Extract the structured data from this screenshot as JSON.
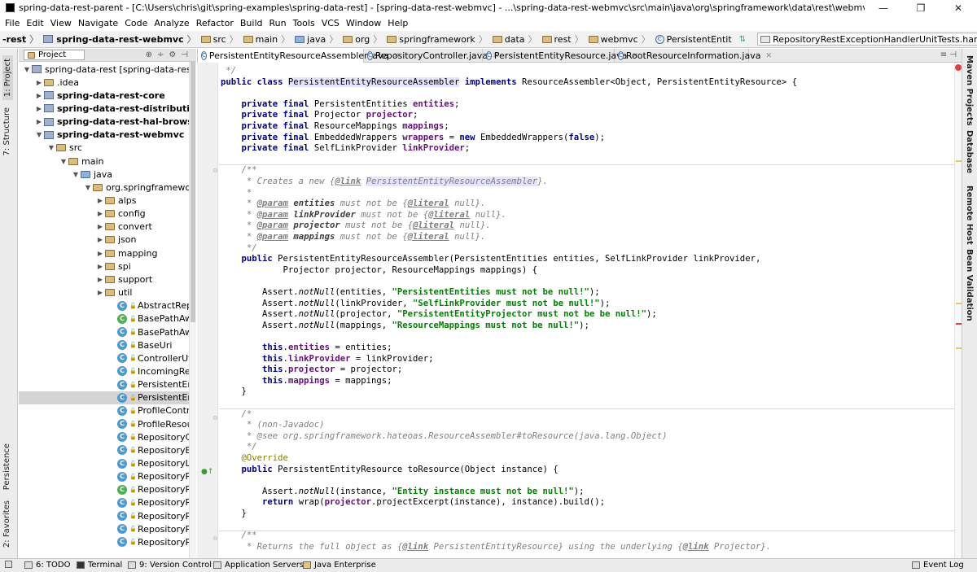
{
  "window": {
    "title": "spring-data-rest-parent - [C:\\Users\\chris\\git\\spring-examples\\spring-data-rest] - [spring-data-rest-webmvc] - ...\\spring-data-rest-webmvc\\src\\main\\java\\org\\springframework\\data\\rest\\webmvc\\PersistentEntityResourceAssembler.java - IntelliJ ID...",
    "controls": [
      "—",
      "❐",
      "✕"
    ]
  },
  "menu": [
    "File",
    "Edit",
    "View",
    "Navigate",
    "Code",
    "Analyze",
    "Refactor",
    "Build",
    "Run",
    "Tools",
    "VCS",
    "Window",
    "Help"
  ],
  "breadcrumbs": [
    "-rest",
    "spring-data-rest-webmvc",
    "src",
    "main",
    "java",
    "org",
    "springframework",
    "data",
    "rest",
    "webmvc",
    "PersistentEntit"
  ],
  "run_config": "RepositoryRestExceptionHandlerUnitTests.handlesConflictCorrectly",
  "left_tools": [
    "1: Project",
    "7: Structure",
    "Persistence",
    "2: Favorites"
  ],
  "right_tools": [
    "Maven Projects",
    "Database",
    "Remote Host",
    "Bean Validation"
  ],
  "project_panel": {
    "view": "Project",
    "tree": [
      {
        "label": "spring-data-rest [spring-data-rest-pare",
        "icon": "module",
        "level": 0,
        "arrow": "down",
        "bold": false
      },
      {
        "label": ".idea",
        "icon": "folder",
        "level": 1,
        "arrow": "right",
        "bold": false
      },
      {
        "label": "spring-data-rest-core",
        "icon": "module",
        "level": 1,
        "arrow": "right",
        "bold": true
      },
      {
        "label": "spring-data-rest-distribution",
        "icon": "module",
        "level": 1,
        "arrow": "right",
        "bold": true
      },
      {
        "label": "spring-data-rest-hal-browser",
        "icon": "module",
        "level": 1,
        "arrow": "right",
        "bold": true
      },
      {
        "label": "spring-data-rest-webmvc",
        "icon": "module",
        "level": 1,
        "arrow": "down",
        "bold": true
      },
      {
        "label": "src",
        "icon": "folder",
        "level": 2,
        "arrow": "down",
        "bold": false
      },
      {
        "label": "main",
        "icon": "folder",
        "level": 3,
        "arrow": "down",
        "bold": false
      },
      {
        "label": "java",
        "icon": "folder-blue",
        "level": 4,
        "arrow": "down",
        "bold": false
      },
      {
        "label": "org.springframework.d",
        "icon": "folder",
        "level": 5,
        "arrow": "down",
        "bold": false
      },
      {
        "label": "alps",
        "icon": "folder",
        "level": 6,
        "arrow": "right",
        "bold": false
      },
      {
        "label": "config",
        "icon": "folder",
        "level": 6,
        "arrow": "right",
        "bold": false
      },
      {
        "label": "convert",
        "icon": "folder",
        "level": 6,
        "arrow": "right",
        "bold": false
      },
      {
        "label": "json",
        "icon": "folder",
        "level": 6,
        "arrow": "right",
        "bold": false
      },
      {
        "label": "mapping",
        "icon": "folder",
        "level": 6,
        "arrow": "right",
        "bold": false
      },
      {
        "label": "spi",
        "icon": "folder",
        "level": 6,
        "arrow": "right",
        "bold": false
      },
      {
        "label": "support",
        "icon": "folder",
        "level": 6,
        "arrow": "right",
        "bold": false
      },
      {
        "label": "util",
        "icon": "folder",
        "level": 6,
        "arrow": "right",
        "bold": false
      },
      {
        "label": "AbstractReposit",
        "icon": "class",
        "level": 7,
        "arrow": "",
        "bold": false
      },
      {
        "label": "BasePathAwareC",
        "icon": "class-green",
        "level": 7,
        "arrow": "",
        "bold": false
      },
      {
        "label": "BasePathAwareH",
        "icon": "class",
        "level": 7,
        "arrow": "",
        "bold": false
      },
      {
        "label": "BaseUri",
        "icon": "class",
        "level": 7,
        "arrow": "",
        "bold": false
      },
      {
        "label": "ControllerUtils",
        "icon": "class",
        "level": 7,
        "arrow": "",
        "bold": false
      },
      {
        "label": "IncomingReques",
        "icon": "class",
        "level": 7,
        "arrow": "",
        "bold": false
      },
      {
        "label": "PersistentEntityR",
        "icon": "class",
        "level": 7,
        "arrow": "",
        "bold": false
      },
      {
        "label": "PersistentEntityR",
        "icon": "class",
        "level": 7,
        "arrow": "",
        "bold": false,
        "selected": true
      },
      {
        "label": "ProfileControlle",
        "icon": "class",
        "level": 7,
        "arrow": "",
        "bold": false
      },
      {
        "label": "ProfileResourceI",
        "icon": "class",
        "level": 7,
        "arrow": "",
        "bold": false
      },
      {
        "label": "RepositoryContr",
        "icon": "class",
        "level": 7,
        "arrow": "",
        "bold": false
      },
      {
        "label": "RepositoryEntity",
        "icon": "class",
        "level": 7,
        "arrow": "",
        "bold": false
      },
      {
        "label": "RepositoryLinksI",
        "icon": "class",
        "level": 7,
        "arrow": "",
        "bold": false
      },
      {
        "label": "RepositoryPrope",
        "icon": "class",
        "level": 7,
        "arrow": "",
        "bold": false
      },
      {
        "label": "RepositoryRestC",
        "icon": "class-green",
        "level": 7,
        "arrow": "",
        "bold": false
      },
      {
        "label": "RepositoryRestD",
        "icon": "class",
        "level": 7,
        "arrow": "",
        "bold": false
      },
      {
        "label": "RepositoryRestE",
        "icon": "class",
        "level": 7,
        "arrow": "",
        "bold": false
      },
      {
        "label": "RepositoryRestH",
        "icon": "class",
        "level": 7,
        "arrow": "",
        "bold": false
      },
      {
        "label": "RepositoryRestH",
        "icon": "class",
        "level": 7,
        "arrow": "",
        "bold": false
      }
    ]
  },
  "tabs": [
    {
      "label": "PersistentEntityResourceAssembler.java",
      "active": true
    },
    {
      "label": "RepositoryController.java",
      "active": false
    },
    {
      "label": "PersistentEntityResource.java",
      "active": false
    },
    {
      "label": "RootResourceInformation.java",
      "active": false
    }
  ],
  "code": [
    [
      [
        "cmt",
        " */"
      ]
    ],
    [
      [
        "kw",
        "public class "
      ],
      [
        "hl",
        "PersistentEntityResourceAssembler"
      ],
      [
        "",
        " "
      ],
      [
        "kw",
        "implements "
      ],
      [
        "",
        "ResourceAssembler<Object, PersistentEntityResource> {"
      ]
    ],
    [],
    [
      [
        "",
        "    "
      ],
      [
        "kw",
        "private final "
      ],
      [
        "",
        "PersistentEntities "
      ],
      [
        "fld",
        "entities"
      ],
      [
        "",
        ";"
      ]
    ],
    [
      [
        "",
        "    "
      ],
      [
        "kw",
        "private final "
      ],
      [
        "",
        "Projector "
      ],
      [
        "fld",
        "projector"
      ],
      [
        "",
        ";"
      ]
    ],
    [
      [
        "",
        "    "
      ],
      [
        "kw",
        "private final "
      ],
      [
        "",
        "ResourceMappings "
      ],
      [
        "fld",
        "mappings"
      ],
      [
        "",
        ";"
      ]
    ],
    [
      [
        "",
        "    "
      ],
      [
        "kw",
        "private final "
      ],
      [
        "",
        "EmbeddedWrappers "
      ],
      [
        "fld",
        "wrappers"
      ],
      [
        "",
        " = "
      ],
      [
        "kw",
        "new "
      ],
      [
        "",
        "EmbeddedWrappers("
      ],
      [
        "kw",
        "false"
      ],
      [
        "",
        ");"
      ]
    ],
    [
      [
        "",
        "    "
      ],
      [
        "kw",
        "private final "
      ],
      [
        "",
        "SelfLinkProvider "
      ],
      [
        "fld",
        "linkProvider"
      ],
      [
        "",
        ";"
      ]
    ],
    [],
    [
      [
        "cmt",
        "    /**"
      ]
    ],
    [
      [
        "cmt",
        "     * Creates a new {"
      ],
      [
        "tag",
        "@link"
      ],
      [
        "cmt",
        " "
      ],
      [
        "cmt hl",
        "PersistentEntityResourceAssembler"
      ],
      [
        "cmt",
        "}."
      ]
    ],
    [
      [
        "cmt",
        "     *"
      ]
    ],
    [
      [
        "cmt",
        "     * "
      ],
      [
        "tag",
        "@param"
      ],
      [
        "cmt",
        " "
      ],
      [
        "prm",
        "entities"
      ],
      [
        "cmt",
        " must not be {"
      ],
      [
        "tag",
        "@literal"
      ],
      [
        "cmt",
        " null}."
      ]
    ],
    [
      [
        "cmt",
        "     * "
      ],
      [
        "tag",
        "@param"
      ],
      [
        "cmt",
        " "
      ],
      [
        "prm",
        "linkProvider"
      ],
      [
        "cmt",
        " must not be {"
      ],
      [
        "tag",
        "@literal"
      ],
      [
        "cmt",
        " null}."
      ]
    ],
    [
      [
        "cmt",
        "     * "
      ],
      [
        "tag",
        "@param"
      ],
      [
        "cmt",
        " "
      ],
      [
        "prm",
        "projector"
      ],
      [
        "cmt",
        " must not be {"
      ],
      [
        "tag",
        "@literal"
      ],
      [
        "cmt",
        " null}."
      ]
    ],
    [
      [
        "cmt",
        "     * "
      ],
      [
        "tag",
        "@param"
      ],
      [
        "cmt",
        " "
      ],
      [
        "prm",
        "mappings"
      ],
      [
        "cmt",
        " must not be {"
      ],
      [
        "tag",
        "@literal"
      ],
      [
        "cmt",
        " null}."
      ]
    ],
    [
      [
        "cmt",
        "     */"
      ]
    ],
    [
      [
        "",
        "    "
      ],
      [
        "kw",
        "public "
      ],
      [
        "",
        "PersistentEntityResourceAssembler(PersistentEntities entities, SelfLinkProvider linkProvider,"
      ]
    ],
    [
      [
        "",
        "            Projector projector, ResourceMappings mappings) {"
      ]
    ],
    [],
    [
      [
        "",
        "        Assert."
      ],
      [
        "stat",
        "notNull"
      ],
      [
        "",
        "(entities, "
      ],
      [
        "str",
        "\"PersistentEntities must not be null!\""
      ],
      [
        "",
        ");"
      ]
    ],
    [
      [
        "",
        "        Assert."
      ],
      [
        "stat",
        "notNull"
      ],
      [
        "",
        "(linkProvider, "
      ],
      [
        "str",
        "\"SelfLinkProvider must not be null!\""
      ],
      [
        "",
        ");"
      ]
    ],
    [
      [
        "",
        "        Assert."
      ],
      [
        "stat",
        "notNull"
      ],
      [
        "",
        "(projector, "
      ],
      [
        "str",
        "\"PersistentEntityProjector must not be be null!\""
      ],
      [
        "",
        ");"
      ]
    ],
    [
      [
        "",
        "        Assert."
      ],
      [
        "stat",
        "notNull"
      ],
      [
        "",
        "(mappings, "
      ],
      [
        "str",
        "\"ResourceMappings must not be null!\""
      ],
      [
        "",
        ");"
      ]
    ],
    [],
    [
      [
        "",
        "        "
      ],
      [
        "kw",
        "this"
      ],
      [
        "",
        "."
      ],
      [
        "fld",
        "entities"
      ],
      [
        "",
        " = entities;"
      ]
    ],
    [
      [
        "",
        "        "
      ],
      [
        "kw",
        "this"
      ],
      [
        "",
        "."
      ],
      [
        "fld",
        "linkProvider"
      ],
      [
        "",
        " = linkProvider;"
      ]
    ],
    [
      [
        "",
        "        "
      ],
      [
        "kw",
        "this"
      ],
      [
        "",
        "."
      ],
      [
        "fld",
        "projector"
      ],
      [
        "",
        " = projector;"
      ]
    ],
    [
      [
        "",
        "        "
      ],
      [
        "kw",
        "this"
      ],
      [
        "",
        "."
      ],
      [
        "fld",
        "mappings"
      ],
      [
        "",
        " = mappings;"
      ]
    ],
    [
      [
        "",
        "    }"
      ]
    ],
    [],
    [
      [
        "cmt",
        "    /*"
      ]
    ],
    [
      [
        "cmt",
        "     * (non-Javadoc)"
      ]
    ],
    [
      [
        "cmt",
        "     * @see org.springframework.hateoas.ResourceAssembler#toResource(java.lang.Object)"
      ]
    ],
    [
      [
        "cmt",
        "     */"
      ]
    ],
    [
      [
        "",
        "    "
      ],
      [
        "ann",
        "@Override"
      ]
    ],
    [
      [
        "",
        "    "
      ],
      [
        "kw",
        "public "
      ],
      [
        "",
        "PersistentEntityResource toResource(Object instance) {"
      ]
    ],
    [],
    [
      [
        "",
        "        Assert."
      ],
      [
        "stat",
        "notNull"
      ],
      [
        "",
        "(instance, "
      ],
      [
        "str",
        "\"Entity instance must not be null!\""
      ],
      [
        "",
        ");"
      ]
    ],
    [
      [
        "",
        "        "
      ],
      [
        "kw",
        "return "
      ],
      [
        "",
        "wrap("
      ],
      [
        "fld",
        "projector"
      ],
      [
        "",
        ".projectExcerpt(instance), instance).build();"
      ]
    ],
    [
      [
        "",
        "    }"
      ]
    ],
    [],
    [
      [
        "cmt",
        "    /**"
      ]
    ],
    [
      [
        "cmt",
        "     * Returns the full object as {"
      ],
      [
        "tag",
        "@link"
      ],
      [
        "cmt",
        " PersistentEntityResource} using the underlying {"
      ],
      [
        "tag",
        "@link"
      ],
      [
        "cmt",
        " Projector}."
      ]
    ]
  ],
  "bottom_tools": [
    "6: TODO",
    "Terminal",
    "9: Version Control",
    "Application Servers",
    "Java Enterprise",
    "Event Log"
  ]
}
